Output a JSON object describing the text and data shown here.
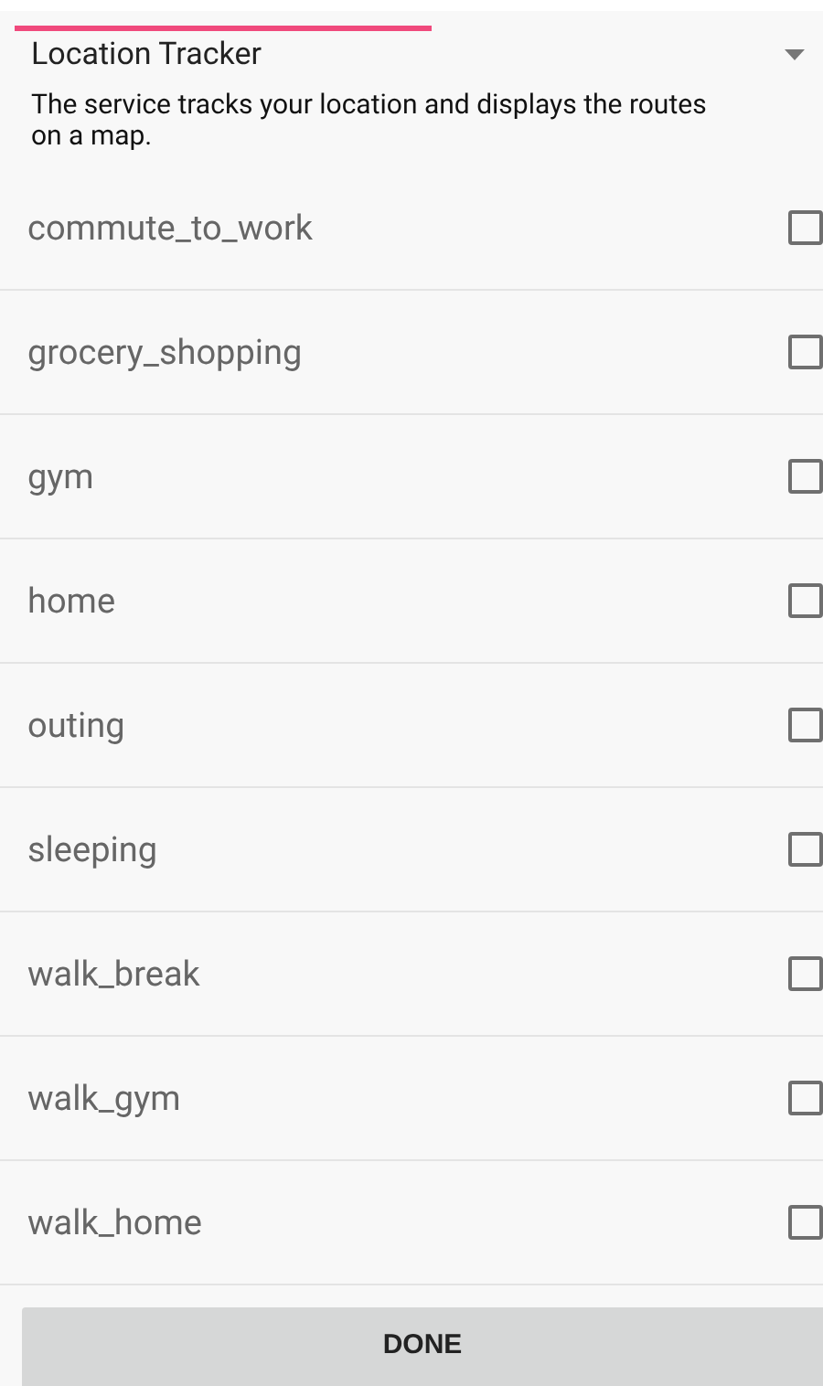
{
  "header": {
    "title": "Location Tracker",
    "description": "The service tracks your location and displays the routes on a map."
  },
  "items": [
    {
      "label": "commute_to_work",
      "checked": false
    },
    {
      "label": "grocery_shopping",
      "checked": false
    },
    {
      "label": "gym",
      "checked": false
    },
    {
      "label": "home",
      "checked": false
    },
    {
      "label": "outing",
      "checked": false
    },
    {
      "label": "sleeping",
      "checked": false
    },
    {
      "label": "walk_break",
      "checked": false
    },
    {
      "label": "walk_gym",
      "checked": false
    },
    {
      "label": "walk_home",
      "checked": false
    }
  ],
  "button": {
    "label": "DONE"
  }
}
